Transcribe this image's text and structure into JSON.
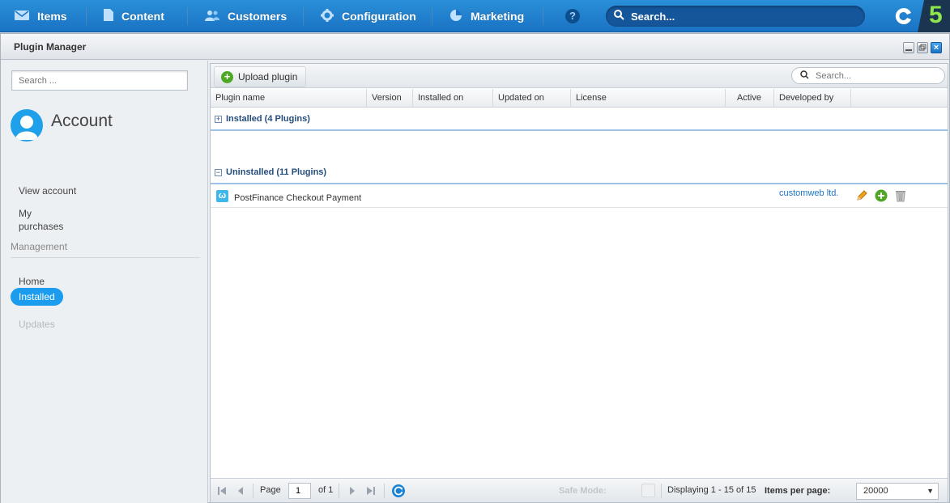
{
  "topnav": {
    "items": [
      {
        "label": "Items",
        "icon": "items-icon"
      },
      {
        "label": "Content",
        "icon": "content-icon"
      },
      {
        "label": "Customers",
        "icon": "customers-icon"
      },
      {
        "label": "Configuration",
        "icon": "gear-icon"
      },
      {
        "label": "Marketing",
        "icon": "pie-chart-icon"
      }
    ],
    "help": "?",
    "search_placeholder": "Search...",
    "logo_number": "5"
  },
  "window": {
    "title": "Plugin Manager"
  },
  "sidebar": {
    "search_placeholder": "Search ...",
    "account_title": "Account",
    "links": [
      "View account",
      "My purchases"
    ],
    "management_heading": "Management",
    "nav": [
      {
        "label": "Home",
        "state": "normal"
      },
      {
        "label": "Installed",
        "state": "active"
      },
      {
        "label": "Updates",
        "state": "disabled"
      }
    ]
  },
  "grid": {
    "upload_label": "Upload plugin",
    "search_placeholder": "Search...",
    "columns": [
      "Plugin name",
      "Version",
      "Installed on",
      "Updated on",
      "License",
      "Active",
      "Developed by"
    ],
    "groups": [
      {
        "label": "Installed (4 Plugins)",
        "expanded": false
      },
      {
        "label": "Uninstalled (11 Plugins)",
        "expanded": true
      }
    ],
    "rows": [
      {
        "name": "PostFinance Checkout Payment",
        "developer": "customweb ltd."
      }
    ]
  },
  "pager": {
    "page_label": "Page",
    "page_value": "1",
    "of_label": "of 1",
    "safe_mode_label": "Safe Mode:",
    "displaying": "Displaying 1 - 15 of 15",
    "items_per_page_label": "Items per page:",
    "items_per_page_value": "20000"
  },
  "colors": {
    "topbar": "#1a73c4",
    "accent": "#1b9cee",
    "group_text": "#244d7c",
    "link": "#1a73c4"
  }
}
